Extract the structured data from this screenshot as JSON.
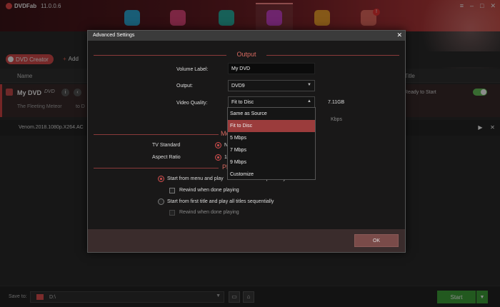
{
  "app": {
    "name": "DVDFab",
    "version": "11.0.0.6"
  },
  "toolbar": {
    "add_label": "Add",
    "dvd_creator_label": "DVD Creator",
    "badge": "!"
  },
  "modules": [
    {
      "name": "copy",
      "color": "#2fa9d8"
    },
    {
      "name": "ripper",
      "color": "#e2467a"
    },
    {
      "name": "converter",
      "color": "#2bb0a0"
    },
    {
      "name": "creator",
      "color": "#c843c6"
    },
    {
      "name": "utilities",
      "color": "#f3a12c"
    },
    {
      "name": "more",
      "color": "#e86a5f"
    }
  ],
  "table": {
    "col_name": "Name",
    "col_title": "Title",
    "row1": {
      "title": "My DVD",
      "format": "DVD",
      "subtitle_left": "The Fleeting Meteor",
      "subtitle_right": "to D",
      "status": "Ready to Start"
    },
    "row2": {
      "title": "Venom.2018.1080p.X264.AC"
    }
  },
  "bottom": {
    "save_to_label": "Save to:",
    "path": "D:\\",
    "start_label": "Start"
  },
  "dialog": {
    "title": "Advanced Settings",
    "output_section": "Output",
    "volume_label_lbl": "Volume Label:",
    "volume_label_value": "My DVD",
    "output_lbl": "Output:",
    "output_value": "DVD9",
    "video_quality_lbl": "Video Quality:",
    "video_quality_value": "Fit to Disc",
    "size_value": "7.11GB",
    "kbps_label": "Kbps",
    "menu_section_partial": "Me",
    "tv_standard_lbl": "TV Standard",
    "tv_standard_partial": "N",
    "aspect_ratio_lbl": "Aspect Ratio",
    "aspect_ratio_partial": "16",
    "playback_section_partial": "Pl",
    "opt_start_menu": "Start from menu and play",
    "opt_start_menu_tail": "sequentially",
    "opt_rewind_1": "Rewind when done playing",
    "opt_start_first": "Start from first title and play all titles sequentially",
    "opt_rewind_2": "Rewind when done playing",
    "ok_label": "OK"
  },
  "quality_options": [
    "Same as Source",
    "Fit to Disc",
    "5 Mbps",
    "7 Mbps",
    "9 Mbps",
    "Customize"
  ],
  "quality_selected": "Fit to Disc"
}
